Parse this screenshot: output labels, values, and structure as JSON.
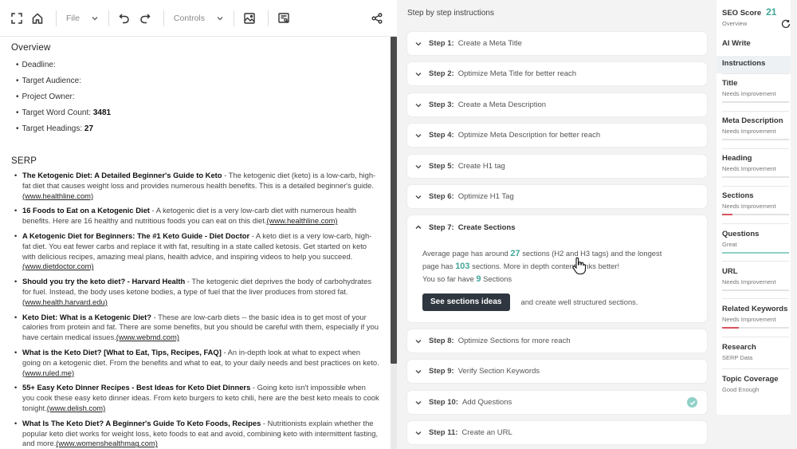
{
  "toolbar": {
    "file_label": "File",
    "controls_label": "Controls"
  },
  "overview": {
    "heading": "Overview",
    "items": [
      {
        "label": "Deadline:",
        "value": ""
      },
      {
        "label": "Target Audience:",
        "value": ""
      },
      {
        "label": "Project Owner:",
        "value": ""
      },
      {
        "label": "Target Word Count:",
        "value": "3481"
      },
      {
        "label": "Target Headings:",
        "value": "27"
      }
    ]
  },
  "serp": {
    "heading": "SERP",
    "items": [
      {
        "title": "The Ketogenic Diet: A Detailed Beginner's Guide to Keto",
        "desc": " - The ketogenic diet (keto) is a low-carb, high-fat diet that causes weight loss and provides numerous health benefits. This is a detailed beginner's guide.",
        "link": "(www.healthline.com)"
      },
      {
        "title": "16 Foods to Eat on a Ketogenic Diet",
        "desc": " - A ketogenic diet is a very low-carb diet with numerous health benefits. Here are 16 healthy and nutritious foods you can eat on this diet.",
        "link": "(www.healthline.com)"
      },
      {
        "title": "A Ketogenic Diet for Beginners: The #1 Keto Guide - Diet Doctor",
        "desc": " - A keto diet is a very low-carb, high-fat diet. You eat fewer carbs and replace it with fat, resulting in a state called ketosis. Get started on keto with delicious recipes, amazing meal plans, health advice, and inspiring videos to help you succeed.",
        "link": "(www.dietdoctor.com)"
      },
      {
        "title": "Should you try the keto diet? - Harvard Health",
        "desc": " - The ketogenic diet deprives the body of carbohydrates for fuel. Instead, the body uses ketone bodies, a type of fuel that the liver produces from stored fat.",
        "link": "(www.health.harvard.edu)"
      },
      {
        "title": "Keto Diet: What is a Ketogenic Diet?",
        "desc": " - These are low-carb diets -- the basic idea is to get most of your calories from protein and fat. There are some benefits, but you should be careful with them, especially if you have certain medical issues.",
        "link": "(www.webmd.com)"
      },
      {
        "title": "What is the Keto Diet? [What to Eat, Tips, Recipes, FAQ]",
        "desc": " - An in-depth look at what to expect when going on a ketogenic diet. From the benefits and what to eat, to your daily needs and best practices on keto.",
        "link": "(www.ruled.me)"
      },
      {
        "title": "55+ Easy Keto Dinner Recipes - Best Ideas for Keto Diet Dinners",
        "desc": " - Going keto isn't impossible when you cook these easy keto dinner ideas. From keto burgers to keto chili, here are the best keto meals to cook tonight.",
        "link": "(www.delish.com)"
      },
      {
        "title": "What Is The Keto Diet? A Beginner's Guide To Keto Foods, Recipes",
        "desc": " - Nutritionists explain whether the popular keto diet works for weight loss, keto foods to eat and avoid, combining keto with intermittent fasting, and more.",
        "link": "(www.womenshealthmag.com)"
      }
    ]
  },
  "steps": {
    "heading": "Step by step instructions",
    "items": [
      {
        "num": "Step 1:",
        "label": "Create a Meta Title"
      },
      {
        "num": "Step 2:",
        "label": "Optimize Meta Title for better reach"
      },
      {
        "num": "Step 3:",
        "label": "Create a Meta Description"
      },
      {
        "num": "Step 4:",
        "label": "Optimize Meta Description for better reach"
      },
      {
        "num": "Step 5:",
        "label": "Create H1 tag"
      },
      {
        "num": "Step 6:",
        "label": "Optimize H1 Tag"
      },
      {
        "num": "Step 8:",
        "label": "Optimize Sections for more reach"
      },
      {
        "num": "Step 9:",
        "label": "Verify Section Keywords"
      },
      {
        "num": "Step 10:",
        "label": "Add Questions"
      },
      {
        "num": "Step 11:",
        "label": "Create an URL"
      }
    ],
    "open": {
      "num": "Step 7:",
      "label": "Create Sections",
      "line1_a": "Average page has around",
      "avg": "27",
      "line1_b": "sections (H2 and H3 tags) and the longest",
      "line2_a": "page has",
      "longest": "103",
      "line2_b": "sections. More in depth content ranks better!",
      "line3_a": "You so far have",
      "have": "9",
      "line3_b": "Sections",
      "button": "See sections ideas",
      "after_button": "and create well structured sections."
    }
  },
  "sidebar": {
    "score_label": "SEO Score",
    "score_value": "21",
    "score_sub": "Overview",
    "ai_write": "AI Write",
    "instructions": "Instructions",
    "items": [
      {
        "name": "Title",
        "status": "Needs Improvement",
        "level": 0
      },
      {
        "name": "Meta Description",
        "status": "Needs Improvement",
        "level": 0
      },
      {
        "name": "Heading",
        "status": "Needs Improvement",
        "level": 0
      },
      {
        "name": "Sections",
        "status": "Needs Improvement",
        "level": 0.15
      },
      {
        "name": "Questions",
        "status": "Great",
        "level": 1
      },
      {
        "name": "URL",
        "status": "Needs Improvement",
        "level": 0
      },
      {
        "name": "Related Keywords",
        "status": "Needs Improvement",
        "level": 0.25
      },
      {
        "name": "Research",
        "status": "SERP Data",
        "level": null
      },
      {
        "name": "Topic Coverage",
        "status": "Good Enough",
        "level": null
      }
    ]
  },
  "colors": {
    "accent": "#43a79b",
    "needs": "#d6545f",
    "great": "#8fd0c7",
    "button": "#2f3640"
  }
}
